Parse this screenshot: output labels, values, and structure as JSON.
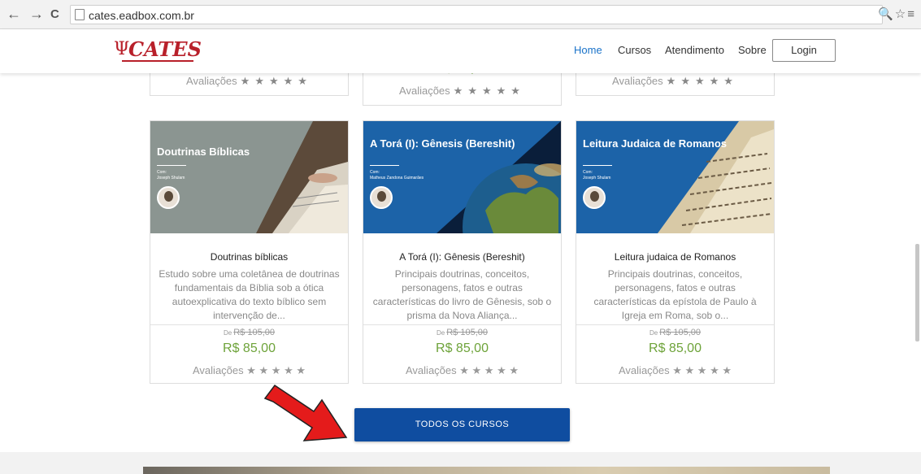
{
  "browser": {
    "url": "cates.eadbox.com.br",
    "back": "←",
    "forward": "→",
    "reload": "C",
    "right_icons": "🔍☆≡"
  },
  "header": {
    "logo": "CATES",
    "nav": [
      "Home",
      "Cursos",
      "Atendimento",
      "Sobre"
    ],
    "login": "Login",
    "active_color": "#1a73c9"
  },
  "fragments": {
    "rating_label": "Avaliações",
    "stars": "★★★★★",
    "price_partial": "R$ 85,00"
  },
  "cards": [
    {
      "thumb_title": "Doutrinas Bíblicas",
      "thumb_com": "Com:",
      "thumb_teacher": "Joseph Shulam",
      "title": "Doutrinas bíblicas",
      "desc": "Estudo sobre uma coletânea de doutrinas fundamentais da Bíblia sob a ótica autoexplicativa do texto bíblico sem intervenção de...",
      "de": "De",
      "old_price": "R$ 105,00",
      "price": "R$ 85,00",
      "rating_label": "Avaliações",
      "stars": "★ ★ ★ ★ ★"
    },
    {
      "thumb_title": "A Torá (I): Gênesis (Bereshit)",
      "thumb_com": "Com:",
      "thumb_teacher": "Matheus Zandona Guimarães",
      "title": "A Torá (I): Gênesis (Bereshit)",
      "desc": "Principais doutrinas, conceitos, personagens, fatos e outras características do livro de Gênesis, sob o prisma da Nova Aliança...",
      "de": "De",
      "old_price": "R$ 105,00",
      "price": "R$ 85,00",
      "rating_label": "Avaliações",
      "stars": "★ ★ ★ ★ ★"
    },
    {
      "thumb_title": "Leitura Judaica de Romanos",
      "thumb_com": "Com:",
      "thumb_teacher": "Joseph Shulam",
      "title": "Leitura judaica de Romanos",
      "desc": "Principais doutrinas, conceitos, personagens, fatos e outras características da epístola de Paulo à Igreja em Roma, sob o...",
      "de": "De",
      "old_price": "R$ 105,00",
      "price": "R$ 85,00",
      "rating_label": "Avaliações",
      "stars": "★ ★ ★ ★ ★"
    }
  ],
  "cta": {
    "label": "TODOS OS CURSOS"
  }
}
